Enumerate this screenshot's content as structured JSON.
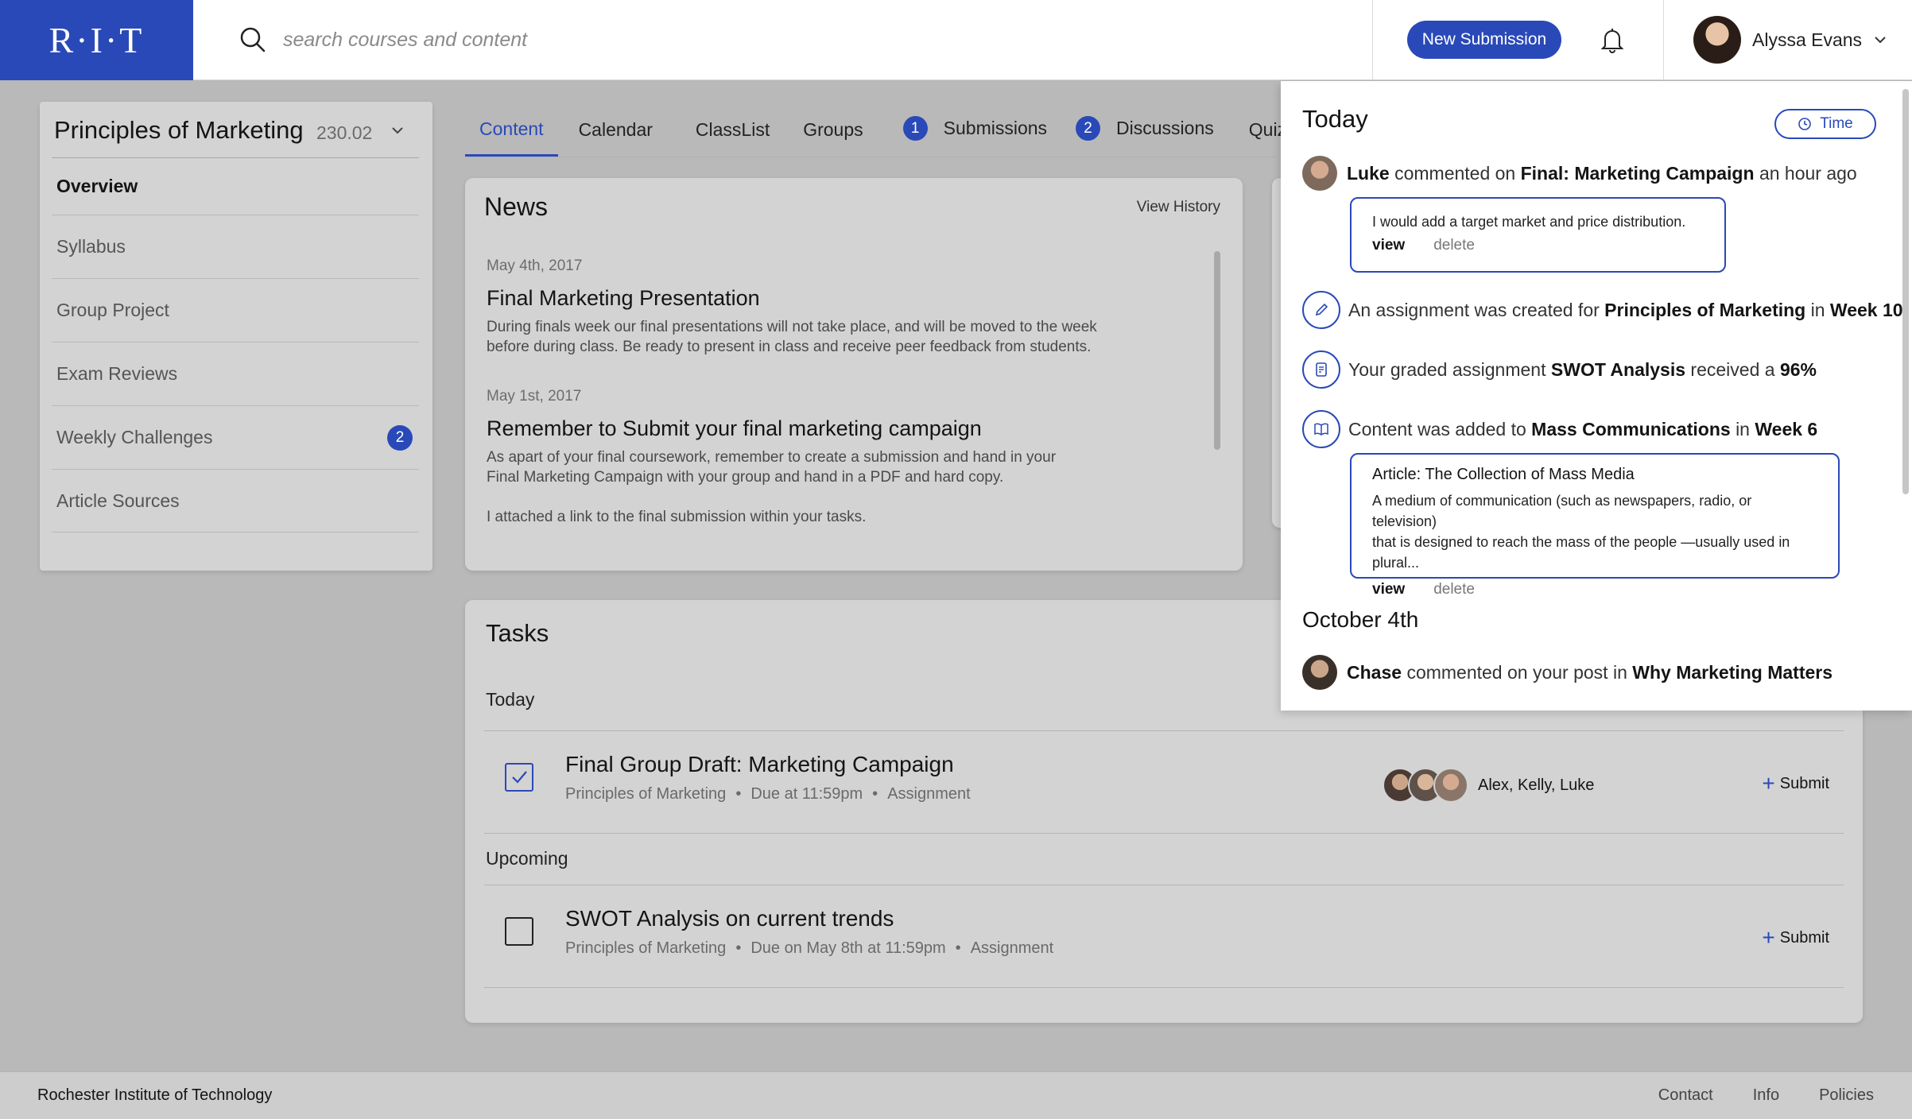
{
  "brand": {
    "logo": "R·I·T",
    "color": "#2a49b8"
  },
  "search": {
    "placeholder": "search courses and content"
  },
  "header": {
    "new_submission": "New Submission",
    "user_name": "Alyssa Evans"
  },
  "course": {
    "title": "Principles of Marketing",
    "code": "230.02",
    "nav": [
      {
        "label": "Overview"
      },
      {
        "label": "Syllabus"
      },
      {
        "label": "Group Project"
      },
      {
        "label": "Exam Reviews"
      },
      {
        "label": "Weekly Challenges",
        "badge": "2"
      },
      {
        "label": "Article Sources"
      }
    ]
  },
  "tabs": [
    {
      "label": "Content"
    },
    {
      "label": "Calendar"
    },
    {
      "label": "ClassList"
    },
    {
      "label": "Groups"
    },
    {
      "label": "Submissions",
      "badge": "1"
    },
    {
      "label": "Discussions",
      "badge": "2"
    },
    {
      "label": "Quizzes"
    }
  ],
  "news": {
    "title": "News",
    "view_history": "View History",
    "items": [
      {
        "date": "May 4th, 2017",
        "headline": "Final Marketing Presentation",
        "body": "During finals week our final presentations will not take place, and will be moved to the week\nbefore during class. Be ready to present in class and receive peer feedback from students."
      },
      {
        "date": "May 1st, 2017",
        "headline": "Remember to Submit your final marketing campaign",
        "body": "As apart of your final coursework, remember to create a submission and hand in your\nFinal Marketing Campaign with your group and hand in a PDF and hard copy.\n\nI attached a link to the final submission within your tasks."
      }
    ]
  },
  "tasks": {
    "title": "Tasks",
    "sections": [
      "Today",
      "Upcoming"
    ],
    "items": [
      {
        "title": "Final Group Draft: Marketing Campaign",
        "course": "Principles of Marketing",
        "due": "Due at 11:59pm",
        "type": "Assignment",
        "group": "Alex, Kelly, Luke",
        "action": "Submit",
        "checked": true
      },
      {
        "title": "SWOT Analysis on current trends",
        "course": "Principles of Marketing",
        "due": "Due on May 8th at 11:59pm",
        "type": "Assignment",
        "action": "Submit",
        "checked": false
      }
    ]
  },
  "notifications": {
    "today_heading": "Today",
    "time_button": "Time",
    "n1": {
      "who": "Luke",
      "mid": "commented on",
      "target": "Final: Marketing Campaign",
      "when": "an hour ago",
      "comment": "I would add a target market and price distribution.",
      "view": "view",
      "delete": "delete"
    },
    "n2": {
      "pre": "An assignment was created for",
      "course": "Principles of Marketing",
      "mid": "in",
      "week": "Week 10"
    },
    "n3": {
      "pre": "Your graded assignment",
      "assignment": "SWOT Analysis",
      "mid": "received a",
      "grade": "96%"
    },
    "n4": {
      "pre": "Content was added to",
      "course": "Mass Communications",
      "mid": "in",
      "week": "Week 6",
      "article_title": "Article: The Collection of Mass Media",
      "article_line1": "A medium of communication (such as newspapers, radio, or television)",
      "article_line2": "that is designed to reach the mass of the people —usually used in plural...",
      "view": "view",
      "delete": "delete"
    },
    "earlier_heading": "October 4th",
    "n5": {
      "who": "Chase",
      "mid": "commented on your post in",
      "target": "Why Marketing Matters"
    }
  },
  "footer": {
    "org": "Rochester Institute of Technology",
    "links": [
      "Contact",
      "Info",
      "Policies"
    ]
  }
}
